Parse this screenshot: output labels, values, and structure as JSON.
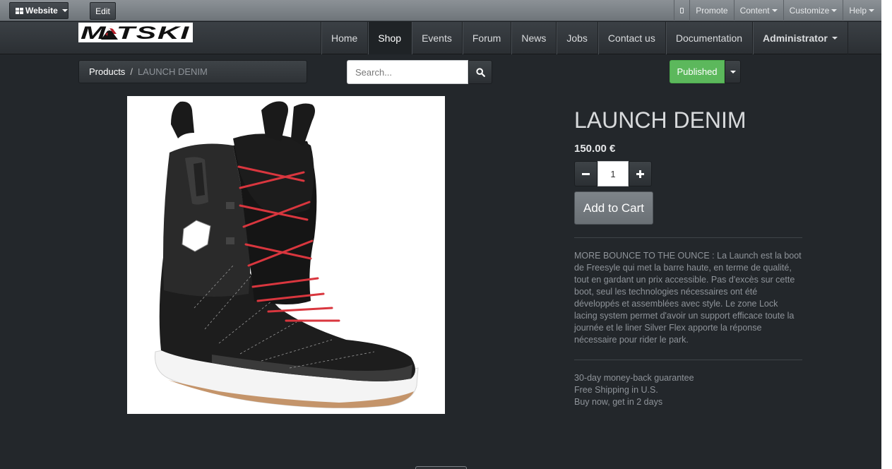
{
  "admin_bar": {
    "website_label": "Website",
    "edit_label": "Edit",
    "right_items": [
      {
        "name": "promote",
        "label": "Promote",
        "dropdown": false
      },
      {
        "name": "content",
        "label": "Content",
        "dropdown": true
      },
      {
        "name": "customize",
        "label": "Customize",
        "dropdown": true
      },
      {
        "name": "help",
        "label": "Help",
        "dropdown": true
      }
    ]
  },
  "logo": {
    "text": "MATSKI"
  },
  "nav": {
    "items": [
      {
        "name": "home",
        "label": "Home",
        "active": false
      },
      {
        "name": "shop",
        "label": "Shop",
        "active": true
      },
      {
        "name": "events",
        "label": "Events",
        "active": false
      },
      {
        "name": "forum",
        "label": "Forum",
        "active": false
      },
      {
        "name": "news",
        "label": "News",
        "active": false
      },
      {
        "name": "jobs",
        "label": "Jobs",
        "active": false
      },
      {
        "name": "contact-us",
        "label": "Contact us",
        "active": false
      },
      {
        "name": "documentation",
        "label": "Documentation",
        "active": false
      }
    ],
    "user_label": "Administrator"
  },
  "breadcrumb": {
    "parent": "Products",
    "separator": "/",
    "current": "LAUNCH DENIM"
  },
  "search": {
    "placeholder": "Search...",
    "value": ""
  },
  "publish": {
    "label": "Published",
    "color": "#5cb85c"
  },
  "product": {
    "title": "LAUNCH DENIM",
    "price": "150.00 €",
    "quantity": "1",
    "add_to_cart_label": "Add to Cart",
    "description": "MORE BOUNCE TO THE OUNCE : La Launch est la boot de Freesyle qui met la barre haute, en terme de qualité, tout en gardant un prix accessible. Pas d'excès sur cette boot, seul les technologies nécessaires ont été développés et assemblées avec style. Le zone Lock lacing system permet d'avoir un support efficace toute la journée et le liner Silver Flex apporte la réponse nécessaire pour rider le park.",
    "guarantees": [
      "30-day money-back guarantee",
      "Free Shipping in U.S.",
      "Buy now, get in 2 days"
    ],
    "image_alt_icon": "snowboard-boot-image"
  },
  "colors": {
    "page_bg": "#23272b",
    "accent_green": "#5cb85c",
    "muted_text": "#8e9399",
    "lace_red": "#d9363e"
  }
}
